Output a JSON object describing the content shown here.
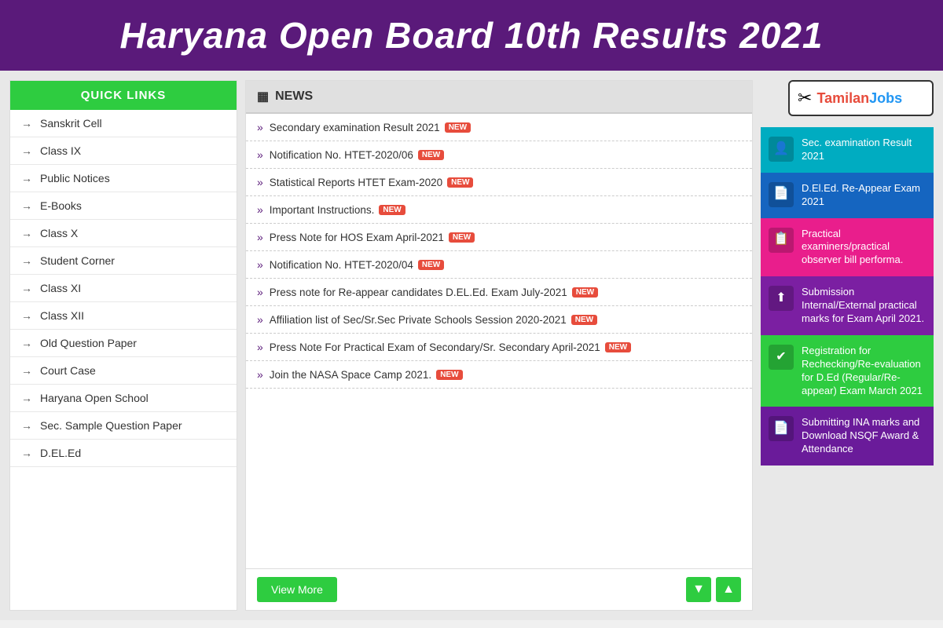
{
  "header": {
    "title": "Haryana Open Board 10th Results 2021"
  },
  "sidebar": {
    "header": "QUICK LINKS",
    "items": [
      {
        "label": "Sanskrit Cell"
      },
      {
        "label": "Class IX"
      },
      {
        "label": "Public Notices"
      },
      {
        "label": "E-Books"
      },
      {
        "label": "Class X"
      },
      {
        "label": "Student Corner"
      },
      {
        "label": "Class XI"
      },
      {
        "label": "Class XII"
      },
      {
        "label": "Old Question Paper"
      },
      {
        "label": "Court Case"
      },
      {
        "label": "Haryana Open School"
      },
      {
        "label": "Sec. Sample Question Paper"
      },
      {
        "label": "D.EL.Ed"
      }
    ]
  },
  "news": {
    "header": "NEWS",
    "items": [
      {
        "text": "Secondary examination Result 2021",
        "badge": true
      },
      {
        "text": "Notification No. HTET-2020/06",
        "badge": true
      },
      {
        "text": "Statistical Reports HTET Exam-2020",
        "badge": true
      },
      {
        "text": "Important Instructions.",
        "badge": true
      },
      {
        "text": "Press Note for HOS Exam April-2021",
        "badge": true
      },
      {
        "text": "Notification No. HTET-2020/04",
        "badge": true
      },
      {
        "text": "Press note for Re-appear candidates D.EL.Ed. Exam July-2021",
        "badge": true
      },
      {
        "text": "Affiliation list of Sec/Sr.Sec Private Schools Session 2020-2021",
        "badge": true
      },
      {
        "text": "Press Note For Practical Exam of Secondary/Sr. Secondary April-2021",
        "badge": true
      },
      {
        "text": "Join the NASA Space Camp 2021.",
        "badge": true
      }
    ],
    "view_more": "View More"
  },
  "right_panel": {
    "logo": {
      "icon": "✂",
      "text_tamilan": "Tamilan",
      "text_jobs": "Jobs"
    },
    "cards": [
      {
        "color": "teal",
        "text": "Sec. examination Result 2021",
        "icon": "👤"
      },
      {
        "color": "blue-dark",
        "text": "D.El.Ed. Re-Appear Exam 2021",
        "icon": "📄"
      },
      {
        "color": "pink",
        "text": "Practical examiners/practical observer bill performa.",
        "icon": "📋"
      },
      {
        "color": "purple",
        "text": "Submission Internal/External practical marks for Exam April 2021.",
        "icon": "⬆"
      },
      {
        "color": "green",
        "text": "Registration for Rechecking/Re-evaluation for D.Ed (Regular/Re-appear) Exam March 2021",
        "icon": "✔"
      },
      {
        "color": "dark-purple",
        "text": "Submitting INA marks and Download NSQF Award & Attendance",
        "icon": "📄"
      }
    ]
  }
}
